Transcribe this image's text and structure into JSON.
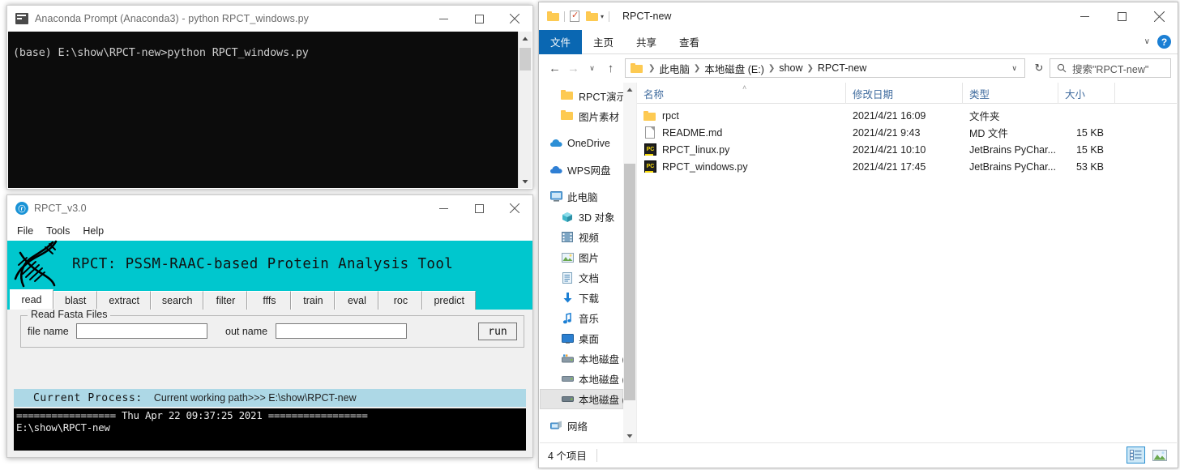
{
  "cmd_window": {
    "title": "Anaconda Prompt (Anaconda3) - python  RPCT_windows.py",
    "icon": "console-icon",
    "console_text": "(base) E:\\show\\RPCT-new>python RPCT_windows.py",
    "minimize": "─",
    "maximize": "□",
    "close": "✕"
  },
  "rpct_window": {
    "title": "RPCT_v3.0",
    "logo_text": "ⓡ",
    "menu": [
      "File",
      "Tools",
      "Help"
    ],
    "banner_title": "RPCT: PSSM-RAAC-based Protein Analysis Tool",
    "tabs": [
      {
        "label": "read",
        "active": true
      },
      {
        "label": "blast",
        "active": false
      },
      {
        "label": "extract",
        "active": false
      },
      {
        "label": "search",
        "active": false
      },
      {
        "label": "filter",
        "active": false
      },
      {
        "label": "fffs",
        "active": false
      },
      {
        "label": "train",
        "active": false
      },
      {
        "label": "eval",
        "active": false
      },
      {
        "label": "roc",
        "active": false
      },
      {
        "label": "predict",
        "active": false
      }
    ],
    "groupbox_label": "Read Fasta Files",
    "file_name_label": "file name",
    "file_name_value": "",
    "out_name_label": "out name",
    "out_name_value": "",
    "run_label": "run",
    "process_label": "Current Process:",
    "process_value": "Current working path>>> E:\\show\\RPCT-new",
    "console_text": "================= Thu Apr 22 09:37:25 2021 =================\nE:\\show\\RPCT-new",
    "minimize": "─",
    "maximize": "□",
    "close": "✕",
    "banner_color": "#00c7ce",
    "process_bar_color": "#add8e6"
  },
  "explorer": {
    "title": "RPCT-new",
    "quick_access": [
      "folder-icon",
      "properties-icon",
      "new-folder-icon",
      "customize-caret-icon"
    ],
    "ribbon_tabs": [
      "文件",
      "主页",
      "共享",
      "查看"
    ],
    "ribbon_collapse": "∨",
    "help": "?",
    "nav_back": "←",
    "nav_forward": "→",
    "nav_recent": "∨",
    "nav_up": "↑",
    "breadcrumbs": [
      "此电脑",
      "本地磁盘 (E:)",
      "show",
      "RPCT-new"
    ],
    "address_caret": "∨",
    "refresh": "↻",
    "search_placeholder": "搜索\"RPCT-new\"",
    "search_value": "",
    "nav_items": [
      {
        "label": "RPCT演示",
        "icon": "folder-icon",
        "indent": 2,
        "selected": false
      },
      {
        "label": "图片素材",
        "icon": "folder-icon",
        "indent": 2,
        "selected": false
      },
      {
        "label": "",
        "icon": "gap",
        "indent": 0,
        "selected": false
      },
      {
        "label": "OneDrive",
        "icon": "cloud-icon",
        "indent": 1,
        "selected": false
      },
      {
        "label": "",
        "icon": "gap",
        "indent": 0,
        "selected": false
      },
      {
        "label": "WPS网盘",
        "icon": "cloud-icon",
        "indent": 1,
        "selected": false
      },
      {
        "label": "",
        "icon": "gap",
        "indent": 0,
        "selected": false
      },
      {
        "label": "此电脑",
        "icon": "computer-icon",
        "indent": 1,
        "selected": false
      },
      {
        "label": "3D 对象",
        "icon": "3d-objects-icon",
        "indent": 2,
        "selected": false
      },
      {
        "label": "视频",
        "icon": "video-icon",
        "indent": 2,
        "selected": false
      },
      {
        "label": "图片",
        "icon": "pictures-icon",
        "indent": 2,
        "selected": false
      },
      {
        "label": "文档",
        "icon": "documents-icon",
        "indent": 2,
        "selected": false
      },
      {
        "label": "下载",
        "icon": "downloads-icon",
        "indent": 2,
        "selected": false
      },
      {
        "label": "音乐",
        "icon": "music-icon",
        "indent": 2,
        "selected": false
      },
      {
        "label": "桌面",
        "icon": "desktop-icon",
        "indent": 2,
        "selected": false
      },
      {
        "label": "本地磁盘 (C:)",
        "icon": "system-drive-icon",
        "indent": 2,
        "selected": false
      },
      {
        "label": "本地磁盘 (D:)",
        "icon": "drive-icon",
        "indent": 2,
        "selected": false
      },
      {
        "label": "本地磁盘 (E:)",
        "icon": "drive-icon",
        "indent": 2,
        "selected": true
      },
      {
        "label": "",
        "icon": "gap",
        "indent": 0,
        "selected": false
      },
      {
        "label": "网络",
        "icon": "network-icon",
        "indent": 1,
        "selected": false
      }
    ],
    "columns": [
      "名称",
      "修改日期",
      "类型",
      "大小"
    ],
    "sort_indicator": "˄",
    "files": [
      {
        "name": "rpct",
        "icon": "folder-icon",
        "date": "2021/4/21 16:09",
        "type": "文件夹",
        "size": ""
      },
      {
        "name": "README.md",
        "icon": "md-file-icon",
        "date": "2021/4/21 9:43",
        "type": "MD 文件",
        "size": "15 KB"
      },
      {
        "name": "RPCT_linux.py",
        "icon": "pycharm-file-icon",
        "date": "2021/4/21 10:10",
        "type": "JetBrains PyChar...",
        "size": "15 KB"
      },
      {
        "name": "RPCT_windows.py",
        "icon": "pycharm-file-icon",
        "date": "2021/4/21 17:45",
        "type": "JetBrains PyChar...",
        "size": "53 KB"
      }
    ],
    "status_text": "4 个项目",
    "view_details": "details-view-icon",
    "view_thumbnails": "large-icons-view-icon",
    "minimize": "─",
    "maximize": "□",
    "close": "✕",
    "accent_color": "#0a67b2"
  }
}
